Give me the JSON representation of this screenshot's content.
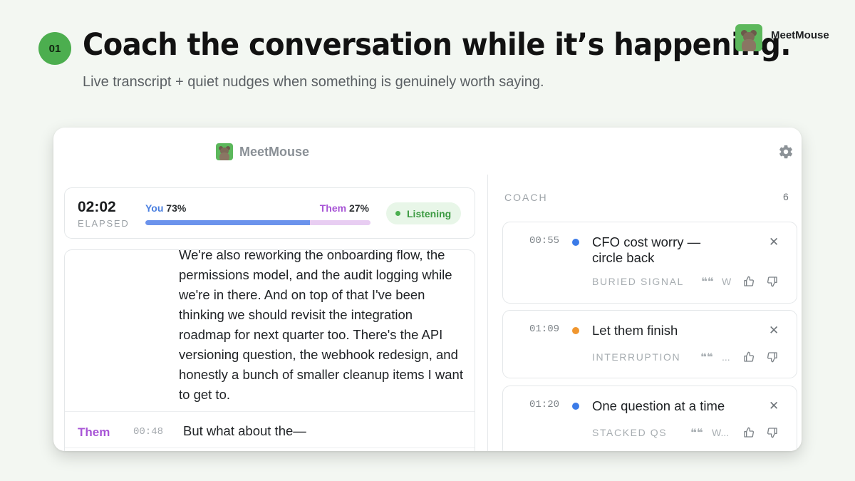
{
  "slide": {
    "step": "01",
    "title": "Coach the conversation while it’s happening.",
    "subtitle": "Live transcript + quiet nudges when something is genuinely worth saying.",
    "brand_name": "MeetMouse"
  },
  "app": {
    "name": "MeetMouse",
    "icons": {
      "logo": "mouse-logo-icon",
      "settings": "gear-icon"
    }
  },
  "stats": {
    "elapsed": "02:02",
    "elapsed_label": "ELAPSED",
    "you_label": "You",
    "you_pct": "73%",
    "you_share": 73,
    "them_label": "Them",
    "them_pct": "27%",
    "status": "Listening",
    "colors": {
      "you": "#4a7fe0",
      "them": "#a855d6",
      "status": "#3c9a42"
    }
  },
  "transcript": {
    "entries": [
      {
        "text": "We're also reworking the onboarding flow, the permissions model, and the audit logging while we're in there. And on top of that I've been thinking we should revisit the integration roadmap for next quarter too. There's the API versioning question, the webhook redesign, and honestly a bunch of smaller cleanup items I want to get to."
      },
      {
        "speaker": "Them",
        "time": "00:48",
        "text": "But what about the—"
      }
    ]
  },
  "coach": {
    "title": "COACH",
    "count": "6",
    "nudges": [
      {
        "time": "00:55",
        "title": "CFO cost worry — circle back",
        "tag": "BURIED SIGNAL",
        "snippet": "W",
        "dot_color": "#3b7be8"
      },
      {
        "time": "01:09",
        "title": "Let them finish",
        "tag": "INTERRUPTION",
        "snippet": "...",
        "dot_color": "#f0962e"
      },
      {
        "time": "01:20",
        "title": "One question at a time",
        "tag": "STACKED QS",
        "snippet": "W...",
        "dot_color": "#3b7be8"
      }
    ],
    "icons": {
      "close": "close-icon",
      "quote": "quote-icon",
      "up": "thumbs-up-icon",
      "down": "thumbs-down-icon"
    }
  }
}
